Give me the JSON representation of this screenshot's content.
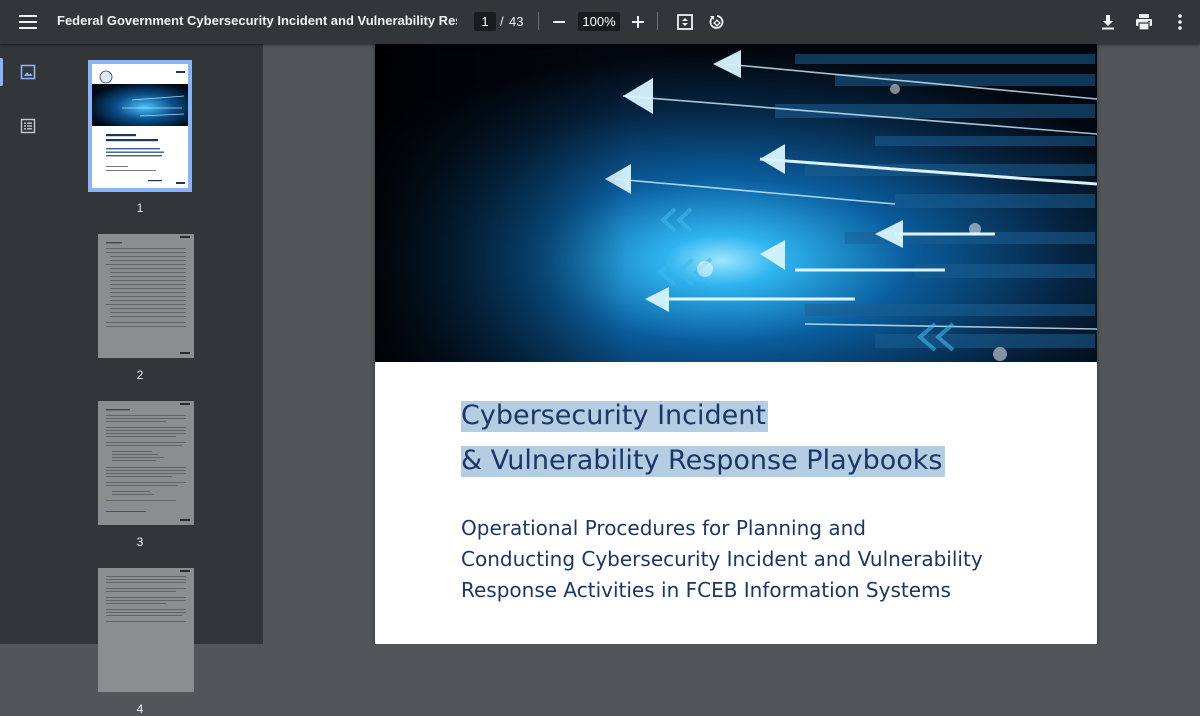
{
  "toolbar": {
    "title": "Federal Government Cybersecurity Incident and Vulnerability Response...",
    "page_current": "1",
    "page_separator": "/",
    "page_total": "43",
    "zoom": "100%"
  },
  "sidebar": {
    "thumbnails": [
      {
        "number": "1",
        "active": true
      },
      {
        "number": "2",
        "active": false
      },
      {
        "number": "3",
        "active": false
      },
      {
        "number": "4",
        "active": false
      }
    ]
  },
  "document": {
    "title_line1": "Cybersecurity Incident ",
    "title_line2": "& Vulnerability Response Playbooks",
    "subtitle_line1": "Operational Procedures for Planning and",
    "subtitle_line2": "Conducting Cybersecurity Incident and Vulnerability",
    "subtitle_line3": "Response Activities in FCEB Information Systems"
  },
  "colors": {
    "toolbar_bg": "#323639",
    "viewer_bg": "#525659",
    "accent": "#8ab4f8",
    "title_text": "#1b3768",
    "highlight": "#b4cde3"
  }
}
